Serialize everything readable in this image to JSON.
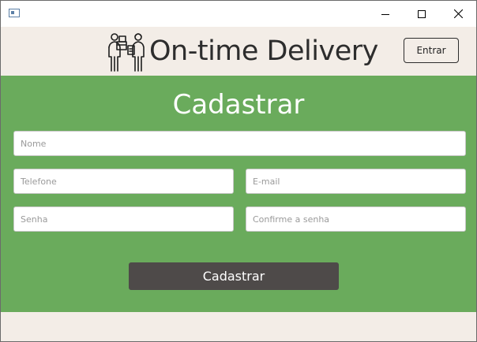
{
  "titlebar": {
    "icon": "window-app-icon",
    "buttons": [
      "minimize-icon",
      "maximize-icon",
      "close-icon"
    ]
  },
  "header": {
    "logo_icon": "delivery-people-icon",
    "title": "On-time Delivery",
    "login_label": "Entrar"
  },
  "form": {
    "title": "Cadastrar",
    "name_placeholder": "Nome",
    "phone_placeholder": "Telefone",
    "email_placeholder": "E-mail",
    "password_placeholder": "Senha",
    "confirm_placeholder": "Confirme a senha",
    "submit_label": "Cadastrar"
  },
  "colors": {
    "panel": "#6aab5c",
    "background": "#f3ede7",
    "submit": "#4e4a49",
    "title_text": "#2d2d2d"
  }
}
